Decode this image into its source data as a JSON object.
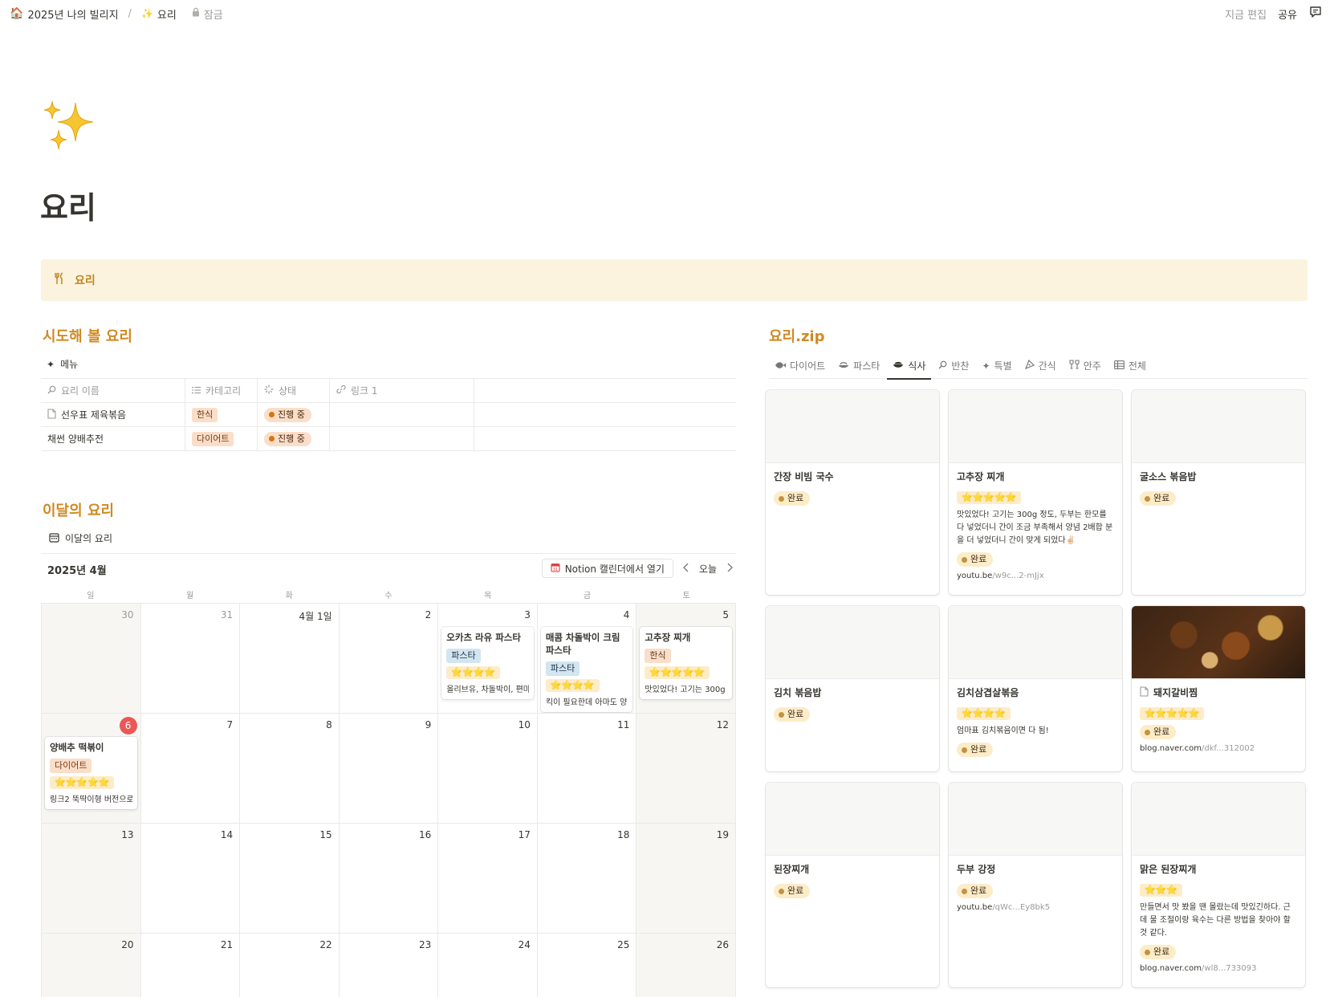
{
  "breadcrumb": {
    "workspace": "2025년 나의 빌리지",
    "separator": "/",
    "page": "요리",
    "lock": "잠금"
  },
  "topbar": {
    "edited": "지금 편집",
    "share": "공유"
  },
  "page": {
    "title": "요리"
  },
  "callout": {
    "label": "요리"
  },
  "try_section": {
    "heading": "시도해 볼 요리",
    "view": "메뉴",
    "columns": [
      "요리 이름",
      "카테고리",
      "상태",
      "링크 1"
    ],
    "rows": [
      {
        "name": "선우표 제육볶음",
        "category": "한식",
        "status": "진행 중"
      },
      {
        "name": "채썬 양배추전",
        "category": "다이어트",
        "status": "진행 중"
      }
    ]
  },
  "month_section": {
    "heading": "이달의 요리",
    "view": "이달의 요리",
    "month": "2025년 4월",
    "gcal_button": "Notion 캘린더에서 열기",
    "today_button": "오늘",
    "weekdays": [
      "일",
      "월",
      "화",
      "수",
      "목",
      "금",
      "토"
    ],
    "days": [
      "30",
      "31",
      "4월 1일",
      "2",
      "3",
      "4",
      "5",
      "6",
      "7",
      "8",
      "9",
      "10",
      "11",
      "12",
      "13",
      "14",
      "15",
      "16",
      "17",
      "18",
      "19",
      "20",
      "21",
      "22",
      "23",
      "24",
      "25",
      "26"
    ],
    "events": [
      {
        "title": "오카츠 라유 파스타",
        "tag": "파스타",
        "stars": "⭐⭐⭐⭐",
        "note": "올리브유, 차돌박이, 편마"
      },
      {
        "title": "매콤 차돌박이 크림 파스타",
        "tag": "파스타",
        "stars": "⭐⭐⭐⭐",
        "note": "킥이 필요한데 아마도 양"
      },
      {
        "title": "고추장 찌개",
        "tag": "한식",
        "stars": "⭐⭐⭐⭐⭐",
        "note": "맛있었다! 고기는 300g"
      },
      {
        "title": "양배추 떡볶이",
        "tag": "다이어트",
        "stars": "⭐⭐⭐⭐⭐",
        "note": "링크2 뚝딱이형 버전으로"
      }
    ]
  },
  "zip_section": {
    "heading": "요리.zip",
    "tabs": [
      "다이어트",
      "파스타",
      "식사",
      "반찬",
      "특별",
      "간식",
      "안주",
      "전체"
    ],
    "cards": [
      {
        "title": "간장 비빔 국수",
        "status": "완료"
      },
      {
        "title": "고추장 찌개",
        "stars": "⭐⭐⭐⭐⭐",
        "desc": "맛있었다! 고기는 300g 정도, 두부는 한모를 다 넣었더니 간이 조금 부족해서 양념 2배합 분을 더 넣었더니 간이 맞게 되었다✌🏻",
        "status": "완료",
        "url_domain": "youtu.be",
        "url_path": "/w9c...2-mJjx"
      },
      {
        "title": "굴소스 볶음밥",
        "status": "완료"
      },
      {
        "title": "김치 볶음밥",
        "status": "완료"
      },
      {
        "title": "김치삼겹살볶음",
        "stars": "⭐⭐⭐⭐",
        "desc": "엄마표 김치볶음이면 다 됨!",
        "status": "완료"
      },
      {
        "title": "돼지갈비찜",
        "stars": "⭐⭐⭐⭐⭐",
        "status": "완료",
        "url_domain": "blog.naver.com",
        "url_path": "/dkf...312002"
      },
      {
        "title": "된장찌개",
        "status": "완료"
      },
      {
        "title": "두부 강정",
        "status": "완료",
        "url_domain": "youtu.be",
        "url_path": "/qWc...Ey8bk5"
      },
      {
        "title": "맑은 된장찌개",
        "stars": "⭐⭐⭐",
        "desc": "만들면서 맛 봤을 땐 몰랐는데 맛있긴하다. 근데 물 조절이랑 육수는 다른 방법을 찾아야 할 것 같다.",
        "status": "완료",
        "url_domain": "blog.naver.com",
        "url_path": "/wl8...733093"
      }
    ]
  }
}
